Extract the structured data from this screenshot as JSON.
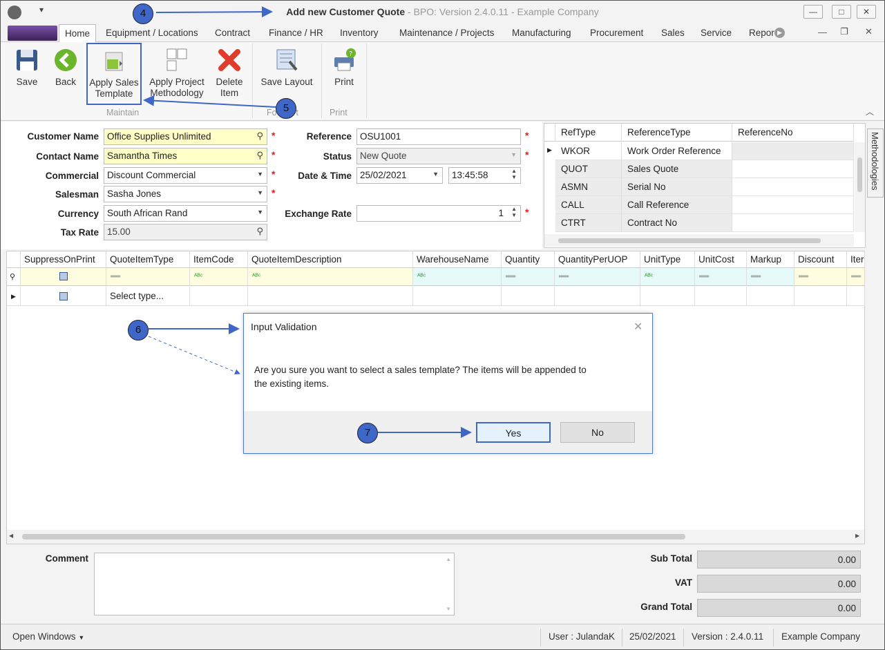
{
  "window": {
    "title_main": "Add new Customer Quote",
    "title_rest": " - BPO: Version 2.4.0.11 - Example Company"
  },
  "tabs": [
    "Home",
    "Equipment / Locations",
    "Contract",
    "Finance / HR",
    "Inventory",
    "Maintenance / Projects",
    "Manufacturing",
    "Procurement",
    "Sales",
    "Service",
    "Repor"
  ],
  "ribbon": {
    "save": "Save",
    "back": "Back",
    "apply_sales_template_1": "Apply Sales",
    "apply_sales_template_2": "Template",
    "apply_project_1": "Apply Project",
    "apply_project_2": "Methodology",
    "delete_1": "Delete",
    "delete_2": "Item",
    "save_layout": "Save Layout",
    "print": "Print",
    "group_maintain": "Maintain",
    "group_format": "Fo",
    "group_format_end": "t",
    "group_print": "Print"
  },
  "form": {
    "customer_name_label": "Customer Name",
    "customer_name": "Office Supplies Unlimited",
    "contact_name_label": "Contact Name",
    "contact_name": "Samantha Times",
    "commercial_label": "Commercial",
    "commercial": "Discount Commercial",
    "salesman_label": "Salesman",
    "salesman": "Sasha Jones",
    "currency_label": "Currency",
    "currency": "South African Rand",
    "tax_rate_label": "Tax Rate",
    "tax_rate": "15.00",
    "reference_label": "Reference",
    "reference": "OSU1001",
    "status_label": "Status",
    "status": "New Quote",
    "datetime_label": "Date & Time",
    "date": "25/02/2021",
    "time": "13:45:58",
    "exchange_rate_label": "Exchange Rate",
    "exchange_rate": "1",
    "required_mark": "*"
  },
  "ref_grid": {
    "headers": [
      "RefType",
      "ReferenceType",
      "ReferenceNo"
    ],
    "rows": [
      {
        "type": "WKOR",
        "ref_type": "Work Order Reference",
        "no": ""
      },
      {
        "type": "QUOT",
        "ref_type": "Sales Quote",
        "no": ""
      },
      {
        "type": "ASMN",
        "ref_type": "Serial No",
        "no": ""
      },
      {
        "type": "CALL",
        "ref_type": "Call Reference",
        "no": ""
      },
      {
        "type": "CTRT",
        "ref_type": "Contract No",
        "no": ""
      }
    ]
  },
  "side_tab": "Methodologies",
  "items_grid": {
    "headers": [
      "SuppressOnPrint",
      "QuoteItemType",
      "ItemCode",
      "QuoteItemDescription",
      "WarehouseName",
      "Quantity",
      "QuantityPerUOP",
      "UnitType",
      "UnitCost",
      "Markup",
      "Discount",
      "Iter"
    ],
    "new_row_type": "Select type..."
  },
  "bottom": {
    "comment_label": "Comment",
    "sub_total_label": "Sub Total",
    "sub_total": "0.00",
    "vat_label": "VAT",
    "vat": "0.00",
    "grand_total_label": "Grand Total",
    "grand_total": "0.00"
  },
  "status_bar": {
    "open_windows": "Open Windows",
    "user": "User : JulandaK",
    "date": "25/02/2021",
    "version": "Version : 2.4.0.11",
    "company": "Example Company"
  },
  "dialog": {
    "title": "Input Validation",
    "message_1": "Are you sure you want to select a sales template? The items will be appended to",
    "message_2": "the existing items.",
    "yes": "Yes",
    "no": "No"
  },
  "annotations": [
    "4",
    "5",
    "6",
    "7"
  ],
  "colors": {
    "annotation_blue": "#3e67c8",
    "required_red": "#e02020",
    "field_yellow": "#ffffc8"
  }
}
